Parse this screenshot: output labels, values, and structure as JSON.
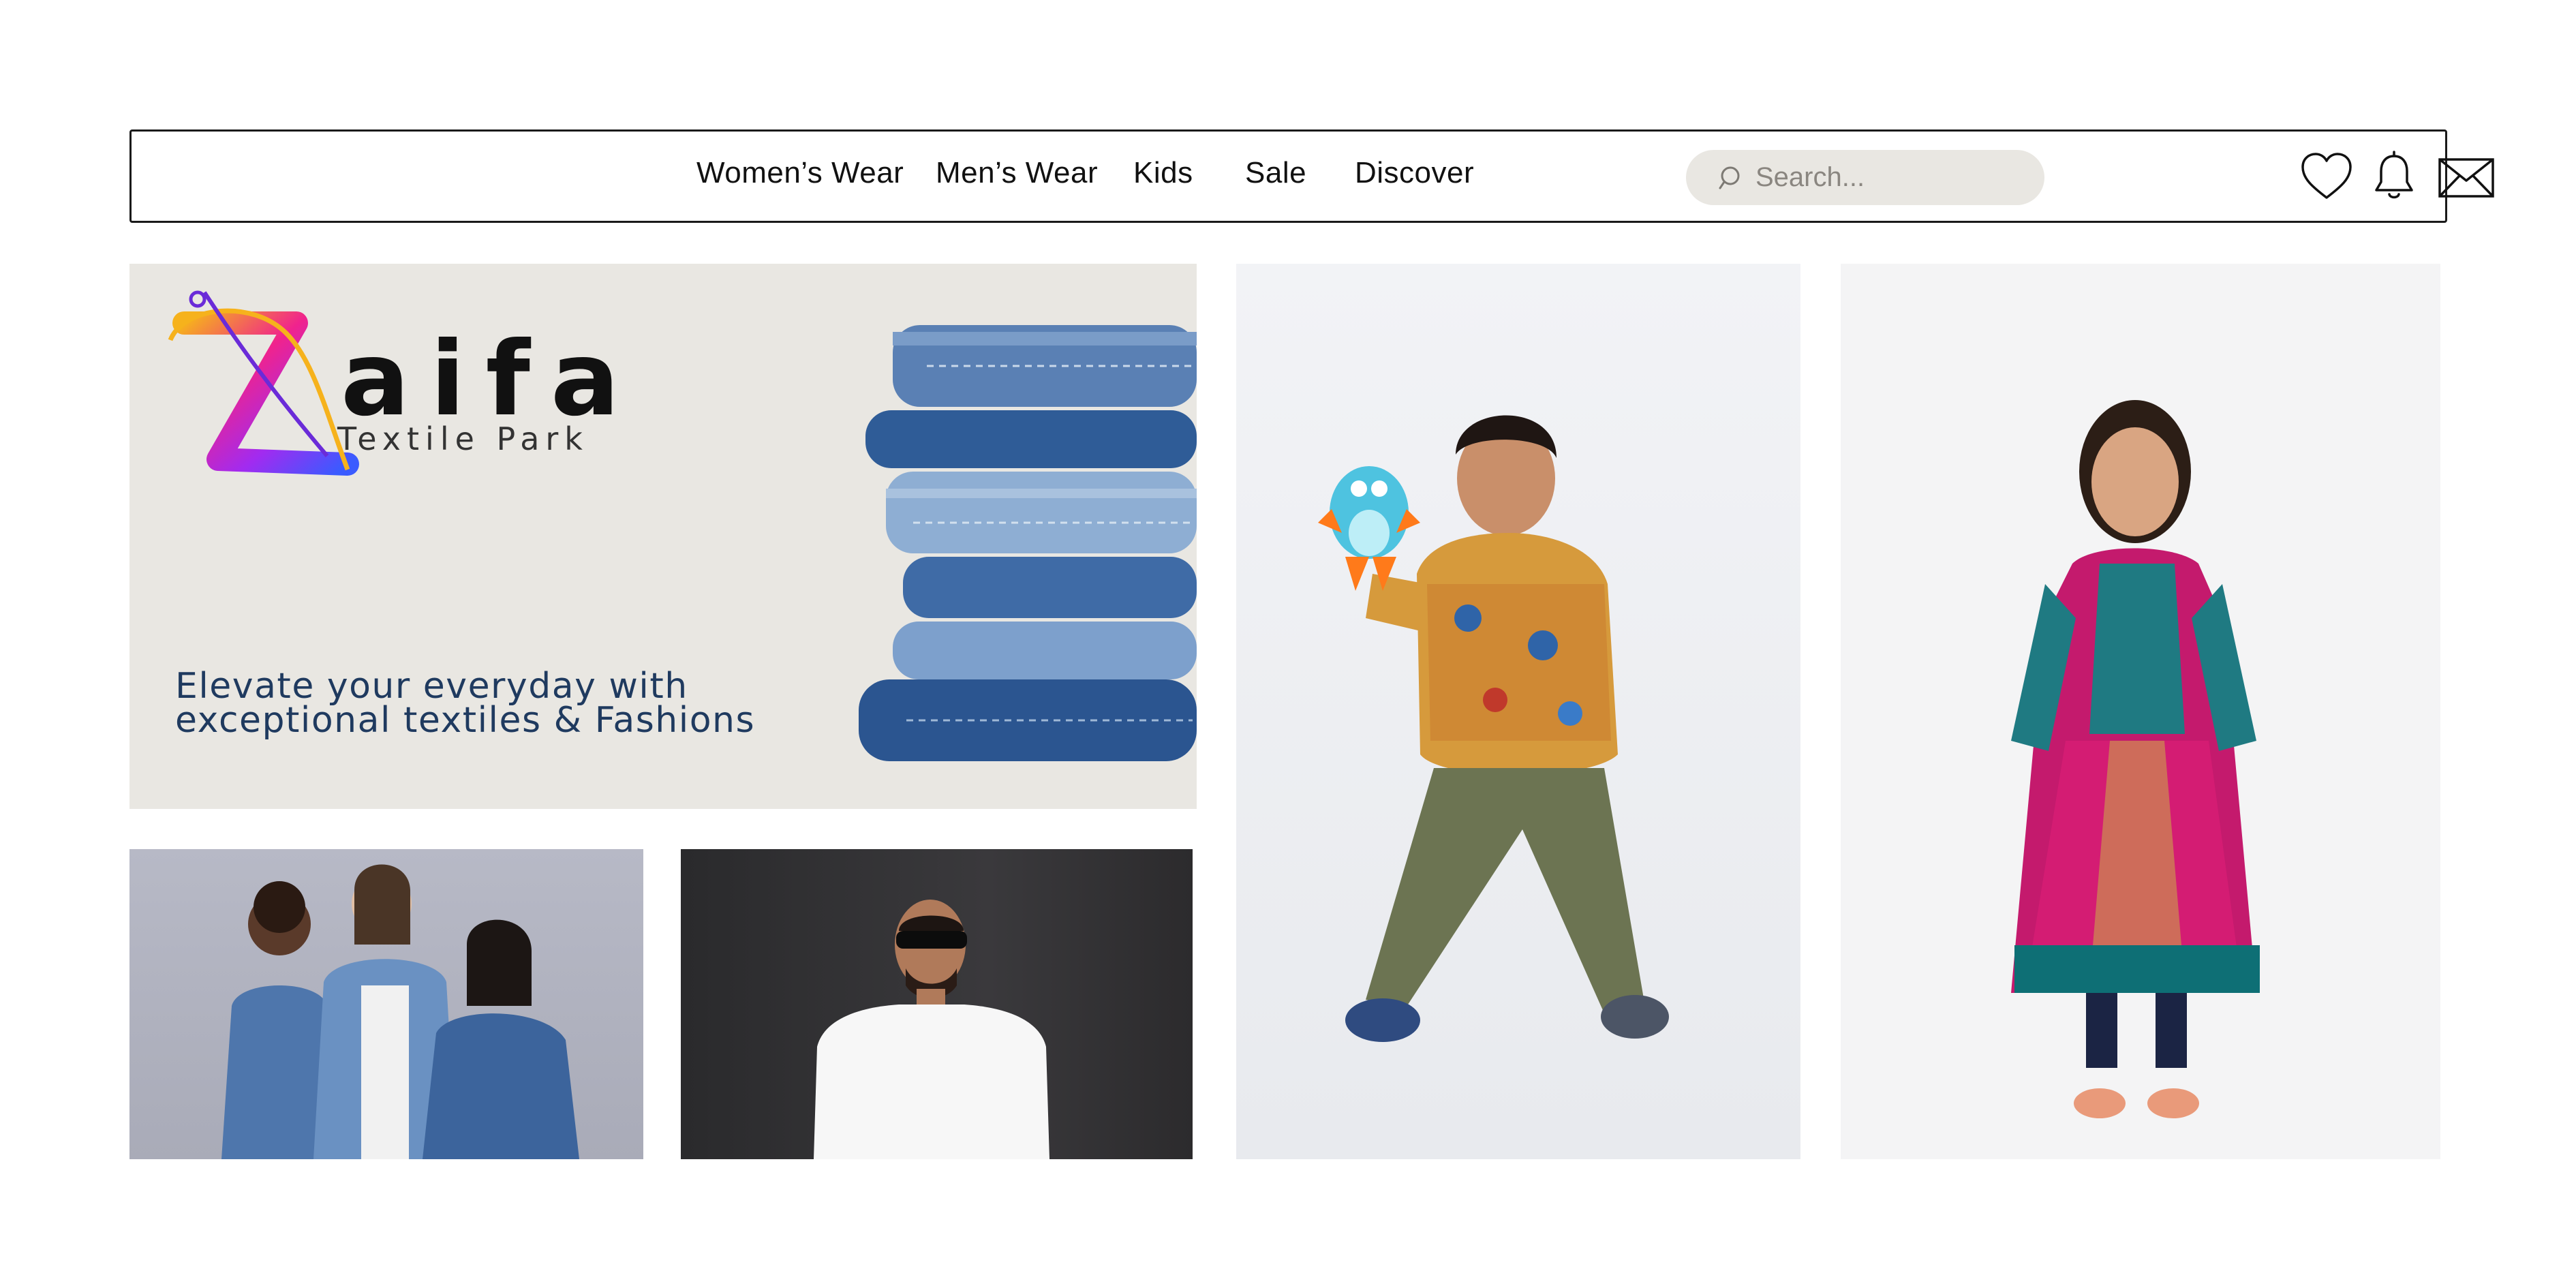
{
  "nav": {
    "links": [
      "Women’s Wear",
      "Men’s Wear",
      "Kids",
      "Sale",
      "Discover"
    ],
    "search_placeholder": "Search...",
    "icons": [
      "heart-icon",
      "bell-icon",
      "mail-icon"
    ]
  },
  "hero": {
    "brand_name": "aifa",
    "brand_sub": "Textile  Park",
    "tagline_line1": "Elevate your everyday with",
    "tagline_line2": "exceptional textiles & Fashions"
  },
  "colors": {
    "hero_bg": "#e9e7e2",
    "tagline": "#1f3a5f",
    "search_bg": "#e9e7e2",
    "denim": "#4a72a8"
  }
}
